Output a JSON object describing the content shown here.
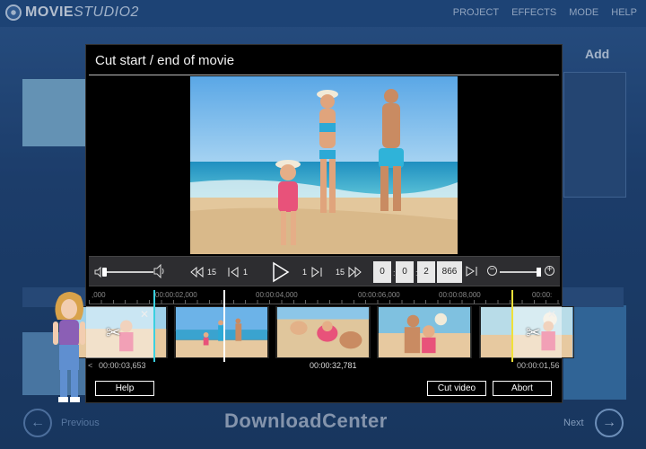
{
  "app": {
    "name_bold": "MOVIE",
    "name_thin": "STUDIO2",
    "toolbar": [
      "PROJECT",
      "EFFECTS",
      "MODE",
      "HELP"
    ],
    "add_label": "Add",
    "back_label": "Previous",
    "next_label": "Next"
  },
  "watermark": "DownloadCenter",
  "dialog": {
    "title": "Cut start / end of movie",
    "controls": {
      "rewind_step": "15",
      "back_step": "1",
      "forward_step": "1",
      "fast_forward_step": "15",
      "frame_fields": [
        "0",
        "0",
        "2",
        "866"
      ]
    },
    "timeline": {
      "ruler_labels": [
        ",000",
        "00:00:02,000",
        "00:00:04,000",
        "00:00:06,000",
        "00:00:08,000",
        "00:00:"
      ],
      "left_arrow": "<",
      "start_time": "00:00:03,653",
      "total_time": "00:00:32,781",
      "end_time": "00:00:01,56"
    },
    "buttons": {
      "help": "Help",
      "cut": "Cut video",
      "abort": "Abort"
    }
  },
  "colors": {
    "start_marker": "#3ad1e0",
    "end_marker": "#f0e13a",
    "dialog_bg": "#000000",
    "app_bg": "#1f4476"
  }
}
